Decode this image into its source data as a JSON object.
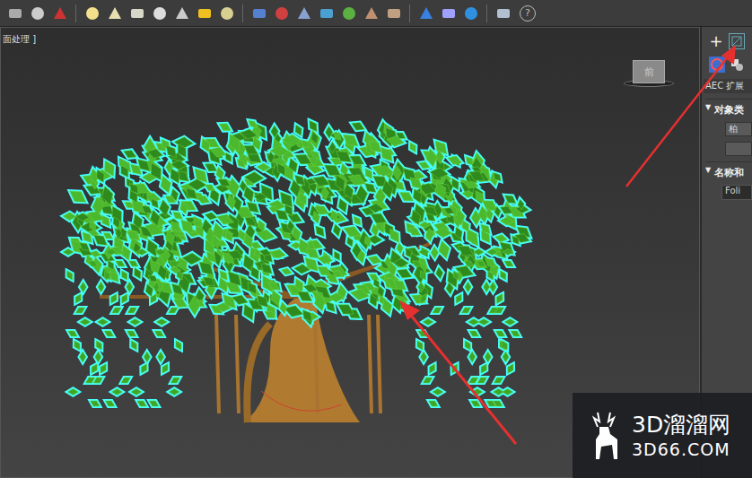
{
  "viewport": {
    "label": "面处理 ]",
    "viewcube": "前"
  },
  "command_panel": {
    "create_button": "+",
    "category": "AEC 扩展",
    "rollouts": [
      {
        "title": "对象类",
        "toggle": "▼",
        "expanded": true
      },
      {
        "title": "名称和",
        "toggle": "▼",
        "expanded": true
      }
    ],
    "object_buttons": [
      "柏"
    ],
    "name_field": "Foli"
  },
  "toolbar": {
    "help": "?"
  },
  "watermark": {
    "title": "3D溜溜网",
    "subtitle": "3D66.COM"
  }
}
